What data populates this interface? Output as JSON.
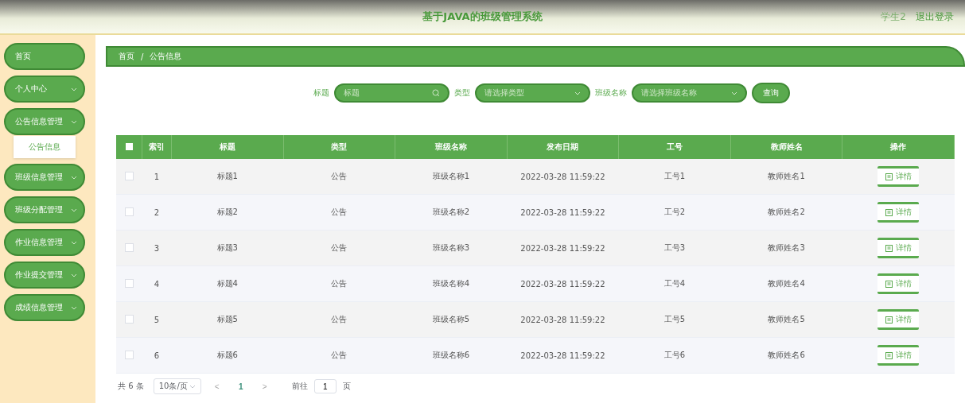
{
  "header": {
    "title": "基于JAVA的班级管理系统",
    "user": "学生2",
    "logout": "退出登录"
  },
  "sidebar": {
    "items": [
      {
        "kind": "link",
        "label": "首页"
      },
      {
        "kind": "group",
        "label": "个人中心"
      },
      {
        "kind": "group",
        "label": "公告信息管理",
        "children": [
          {
            "label": "公告信息"
          }
        ]
      },
      {
        "kind": "group",
        "label": "班级信息管理"
      },
      {
        "kind": "group",
        "label": "班级分配管理"
      },
      {
        "kind": "group",
        "label": "作业信息管理"
      },
      {
        "kind": "group",
        "label": "作业提交管理"
      },
      {
        "kind": "group",
        "label": "成绩信息管理"
      }
    ]
  },
  "breadcrumb": [
    "首页",
    "公告信息"
  ],
  "breadcrumb_separator": "/",
  "filters": [
    {
      "kind": "search",
      "label": "标题",
      "placeholder": "标题"
    },
    {
      "kind": "select",
      "label": "类型",
      "placeholder": "请选择类型"
    },
    {
      "kind": "select",
      "label": "班级名称",
      "placeholder": "请选择班级名称"
    }
  ],
  "query_button": "查询",
  "table": {
    "select_all_checked": false,
    "columns": [
      "索引",
      "标题",
      "类型",
      "班级名称",
      "发布日期",
      "工号",
      "教师姓名",
      "操作"
    ],
    "rows": [
      {
        "checked": false,
        "cells": [
          "1",
          "标题1",
          "公告",
          "班级名称1",
          "2022-03-28 11:59:22",
          "工号1",
          "教师姓名1"
        ],
        "action": "详情"
      },
      {
        "checked": false,
        "cells": [
          "2",
          "标题2",
          "公告",
          "班级名称2",
          "2022-03-28 11:59:22",
          "工号2",
          "教师姓名2"
        ],
        "action": "详情"
      },
      {
        "checked": false,
        "cells": [
          "3",
          "标题3",
          "公告",
          "班级名称3",
          "2022-03-28 11:59:22",
          "工号3",
          "教师姓名3"
        ],
        "action": "详情"
      },
      {
        "checked": false,
        "cells": [
          "4",
          "标题4",
          "公告",
          "班级名称4",
          "2022-03-28 11:59:22",
          "工号4",
          "教师姓名4"
        ],
        "action": "详情"
      },
      {
        "checked": false,
        "cells": [
          "5",
          "标题5",
          "公告",
          "班级名称5",
          "2022-03-28 11:59:22",
          "工号5",
          "教师姓名5"
        ],
        "action": "详情"
      },
      {
        "checked": false,
        "cells": [
          "6",
          "标题6",
          "公告",
          "班级名称6",
          "2022-03-28 11:59:22",
          "工号6",
          "教师姓名6"
        ],
        "action": "详情"
      }
    ]
  },
  "pagination": {
    "total": "共 6 条",
    "page_size": "10条/页",
    "prev": "<",
    "pages": [
      {
        "label": "1",
        "selected": true
      }
    ],
    "next": ">",
    "goto_label": "前往",
    "goto_value": "1",
    "goto_suffix": "页"
  }
}
